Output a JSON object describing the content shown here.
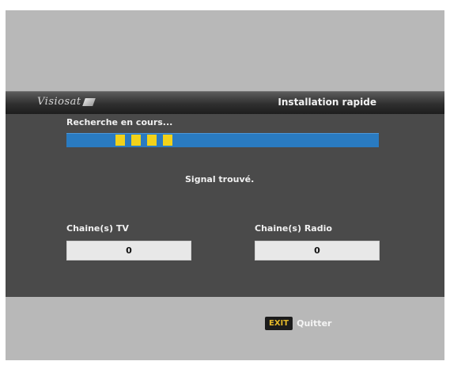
{
  "header": {
    "logo_text": "Visiosat",
    "title": "Installation rapide"
  },
  "scan": {
    "status_label": "Recherche en cours...",
    "progress_active_segments": 4,
    "signal_text": "Signal trouvé."
  },
  "channels": {
    "tv_label": "Chaine(s) TV",
    "tv_count": "0",
    "radio_label": "Chaine(s) Radio",
    "radio_count": "0"
  },
  "footer": {
    "exit_key": "EXIT",
    "exit_label": "Quitter"
  },
  "colors": {
    "progress_bar": "#2a7bc1",
    "progress_segment": "#f2d21a",
    "panel_background": "#4a4a4a",
    "exit_key_text": "#e3b82a"
  }
}
